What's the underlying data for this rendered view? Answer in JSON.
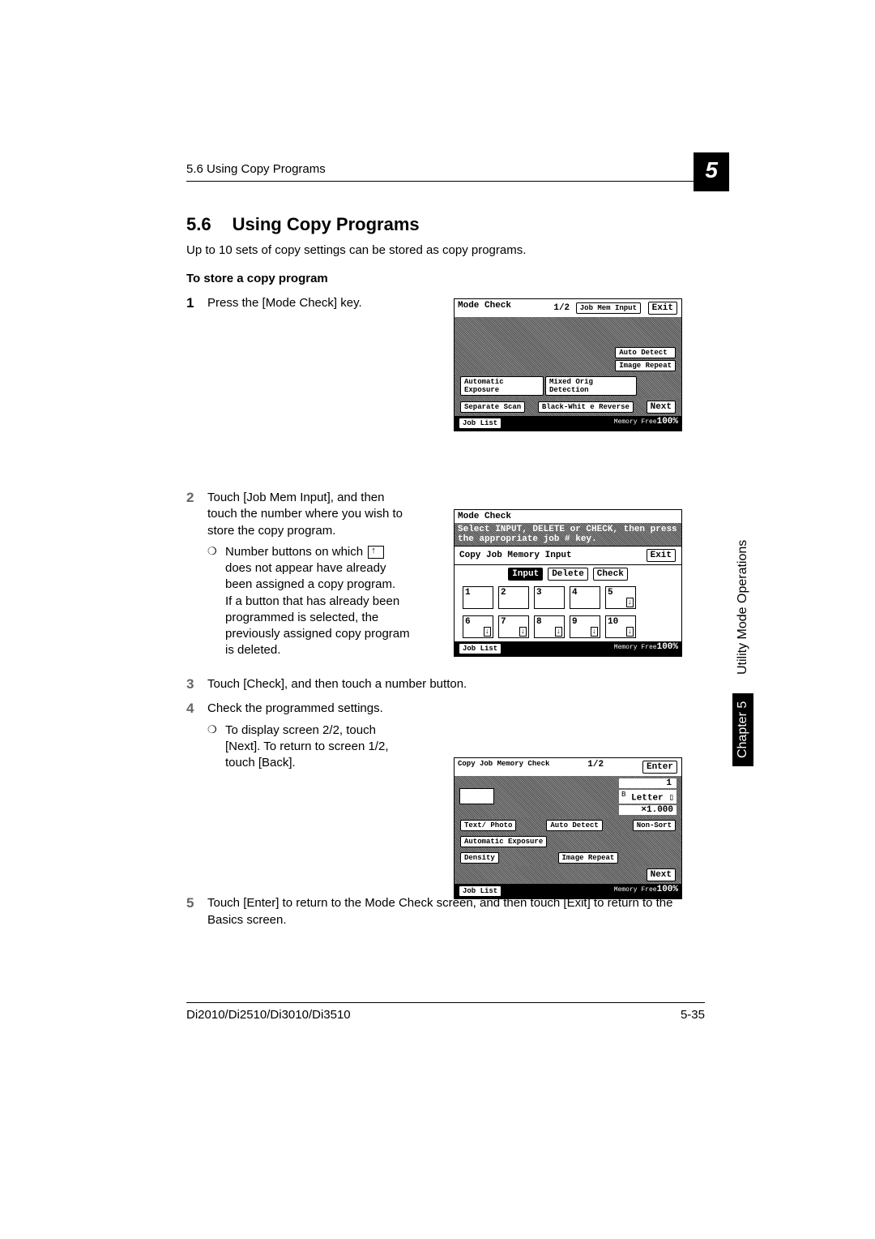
{
  "header": {
    "running": "5.6 Using Copy Programs",
    "chapter_badge": "5"
  },
  "section": {
    "number": "5.6",
    "title": "Using Copy Programs",
    "intro": "Up to 10 sets of copy settings can be stored as copy programs.",
    "subheading": "To store a copy program"
  },
  "steps": {
    "s1": {
      "num": "1",
      "text": "Press the [Mode Check] key."
    },
    "s2": {
      "num": "2",
      "text": "Touch [Job Mem Input], and then touch the number where you wish to store the copy program.",
      "bullet": "Number buttons on which",
      "bullet_cont": "does not appear have already been assigned a copy program.",
      "bullet_note": "If a button that has already been programmed is selected, the previously assigned copy program is deleted."
    },
    "s3": {
      "num": "3",
      "text": "Touch [Check], and then touch a number button."
    },
    "s4": {
      "num": "4",
      "text": "Check the programmed settings.",
      "bullet": "To display screen 2/2, touch [Next]. To return to screen 1/2, touch [Back]."
    },
    "s5": {
      "num": "5",
      "text": "Touch [Enter] to return to the Mode Check screen, and then touch [Exit] to return to the Basics screen."
    }
  },
  "lcd1": {
    "title": "Mode Check",
    "page": "1/2",
    "job_mem": "Job Mem Input",
    "exit": "Exit",
    "auto_detect": "Auto Detect",
    "image_repeat": "Image Repeat",
    "auto_exposure": "Automatic Exposure",
    "mixed": "Mixed Orig Detection",
    "separate": "Separate Scan",
    "bw_reverse": "Black-Whit e Reverse",
    "next": "Next",
    "job_list": "Job List",
    "memory": "Memory Free",
    "mem_pct": "100%"
  },
  "lcd2": {
    "title": "Mode Check",
    "prompt": "Select INPUT, DELETE or CHECK, then press the appropriate job # key.",
    "subtitle": "Copy Job Memory Input",
    "exit": "Exit",
    "input": "Input",
    "delete": "Delete",
    "check": "Check",
    "nums": [
      "1",
      "2",
      "3",
      "4",
      "5",
      "6",
      "7",
      "8",
      "9",
      "10"
    ],
    "job_list": "Job List",
    "memory": "Memory Free",
    "mem_pct": "100%"
  },
  "lcd3": {
    "title": "Copy Job Memory Check",
    "page": "1/2",
    "enter": "Enter",
    "one": "1",
    "paper": "Letter",
    "paper_prefix": "B",
    "zoom": "×1.000",
    "text_photo": "Text/ Photo",
    "auto_detect": "Auto Detect",
    "non_sort": "Non-Sort",
    "auto_exposure": "Automatic Exposure",
    "density": "Density",
    "image_repeat": "Image Repeat",
    "next": "Next",
    "job_list": "Job List",
    "memory": "Memory Free",
    "mem_pct": "100%"
  },
  "side": {
    "chapter": "Chapter 5",
    "text": "Utility Mode Operations"
  },
  "footer": {
    "model": "Di2010/Di2510/Di3010/Di3510",
    "page": "5-35"
  }
}
